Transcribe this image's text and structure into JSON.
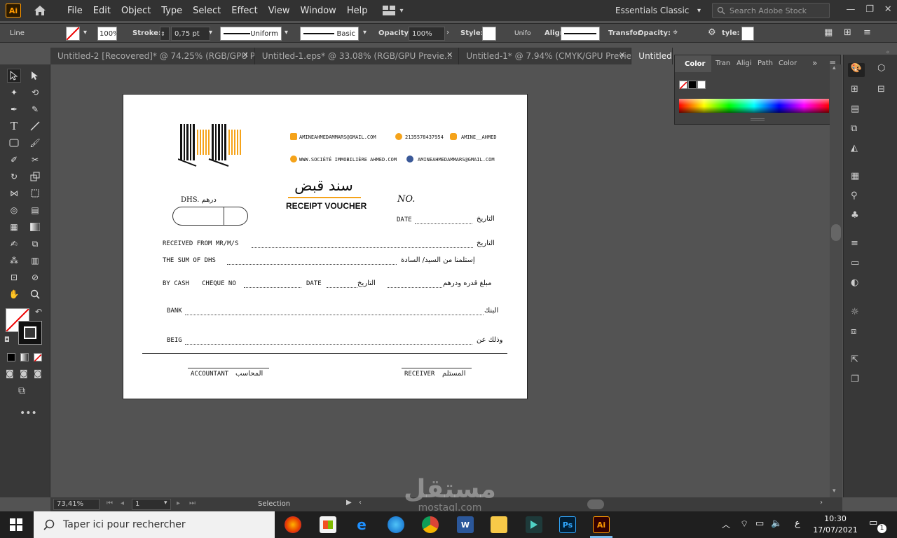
{
  "app": {
    "logo": "Ai"
  },
  "menu": [
    "File",
    "Edit",
    "Object",
    "Type",
    "Select",
    "Effect",
    "View",
    "Window",
    "Help"
  ],
  "workspace": {
    "label": "Essentials Classic"
  },
  "search": {
    "placeholder": "Search Adobe Stock"
  },
  "control_bar": {
    "object_type": "Line",
    "opacity_swatch": "100%",
    "stroke_label": "Stroke:",
    "stroke_value": "0,75 pt",
    "profile": "Uniform",
    "brush": "Basic",
    "opacity_label": "Opacity:",
    "opacity_value": "100%",
    "style_label": "Style:",
    "style_value": "Unifo",
    "align_label": "Align",
    "transform_label": "Transfor",
    "opacity2_label": "Opacity:",
    "type_label": "tyle:"
  },
  "tabs": [
    {
      "label": "Untitled-2 [Recovered]* @ 74.25% (RGB/GPU Pre...",
      "close": "✕"
    },
    {
      "label": "Untitled-1.eps* @ 33.08% (RGB/GPU Previe...",
      "close": "✕"
    },
    {
      "label": "Untitled-1* @ 7.94% (CMYK/GPU Previe...",
      "close": "✕"
    },
    {
      "label": "Untitled-2*",
      "close": ""
    }
  ],
  "color_panel": {
    "tabs": [
      "Color",
      "Tran",
      "Aligi",
      "Path",
      "Color"
    ],
    "more": "»"
  },
  "voucher": {
    "contacts": {
      "email1": "AMINEAHMEDAMMARS@GMAIL.COM",
      "whatsapp": "2135578437954",
      "instagram": "AMINE__AHMED",
      "website": "WWW.SOCIÉTÉ IMMOBILIÈRE AHMED.COM",
      "email2": "AMINEAHMEDAMMARS@GMAIL.COM"
    },
    "title_ar": "سند قبض",
    "title_en": "RECEIPT VOUCHER",
    "no_label": "NO.",
    "dhs_label": "DHS. درهم",
    "date_label": "DATE",
    "date_ar": "التاريخ",
    "received_en": "RECEIVED FROM MR/M/S",
    "received_ar": "التاريخ",
    "sum_en": "THE SUM OF DHS",
    "sum_ar": "إستلمنا من السيد/ السادة",
    "cash_en": "BY CASH",
    "cheque_en": "CHEQUE NO",
    "date2_en": "DATE",
    "date2_ar": "التاريخ",
    "amount_ar": "مبلغ قدره ودرهم",
    "bank_en": "BANK",
    "bank_ar": "البنك",
    "being_en": "BEIG",
    "being_ar": "وذلك عن",
    "accountant_en": "ACCOUNTANT",
    "accountant_ar": "المحاسب",
    "receiver_en": "RECEIVER",
    "receiver_ar": "المستلم"
  },
  "status": {
    "zoom": "73,41%",
    "page": "1",
    "tool": "Selection"
  },
  "taskbar": {
    "search_placeholder": "Taper ici pour rechercher",
    "time": "10:30",
    "date": "17/07/2021",
    "lang": "ع",
    "notif_count": "1",
    "ps_label": "Ps",
    "ai_label": "Ai"
  },
  "watermark": {
    "text_ar": "مستقل",
    "text_en": "mostaql.com"
  },
  "colors": {
    "accent_orange": "#f5a31a",
    "ai_orange": "#ff9a00",
    "panel_dark": "#323232"
  }
}
